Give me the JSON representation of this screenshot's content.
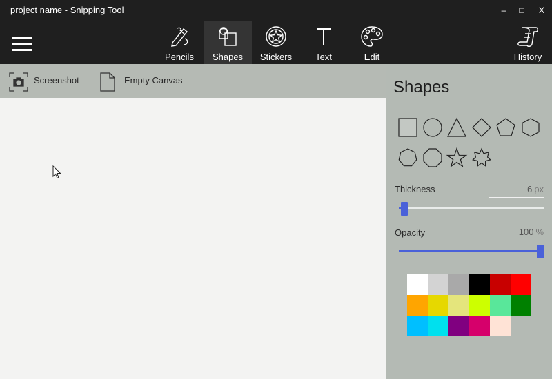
{
  "window": {
    "title": "project name - Snipping Tool",
    "minimize": "–",
    "maximize": "□",
    "close": "X"
  },
  "toolbar": {
    "tools": [
      {
        "label": "Pencils",
        "icon": "pencil-brush-icon",
        "active": false
      },
      {
        "label": "Shapes",
        "icon": "shapes-icon",
        "active": true
      },
      {
        "label": "Stickers",
        "icon": "sticker-star-icon",
        "active": false
      },
      {
        "label": "Text",
        "icon": "text-t-icon",
        "active": false
      },
      {
        "label": "Edit",
        "icon": "palette-icon",
        "active": false
      }
    ],
    "history_label": "History"
  },
  "left": {
    "screenshot_label": "Screenshot",
    "empty_canvas_label": "Empty Canvas"
  },
  "panel": {
    "title": "Shapes",
    "shapes": [
      "square",
      "circle",
      "triangle",
      "diamond",
      "pentagon",
      "hexagon",
      "heptagon",
      "octagon",
      "star-5",
      "star-7"
    ],
    "thickness": {
      "label": "Thickness",
      "value": "6",
      "unit": "px",
      "fraction": 0.04
    },
    "opacity": {
      "label": "Opacity",
      "value": "100",
      "unit": "%",
      "fraction": 1.0
    },
    "colors": [
      "#ffffff",
      "#d3d3d3",
      "#a9a9a9",
      "#000000",
      "#c80000",
      "#ff0000",
      "#ffa500",
      "#e6d800",
      "#e4e57c",
      "#cdff00",
      "#59e79a",
      "#008000",
      "#00bfff",
      "#00e0ee",
      "#800080",
      "#d6006b",
      "#ffe3d6"
    ]
  },
  "accent": "#4a61d9"
}
